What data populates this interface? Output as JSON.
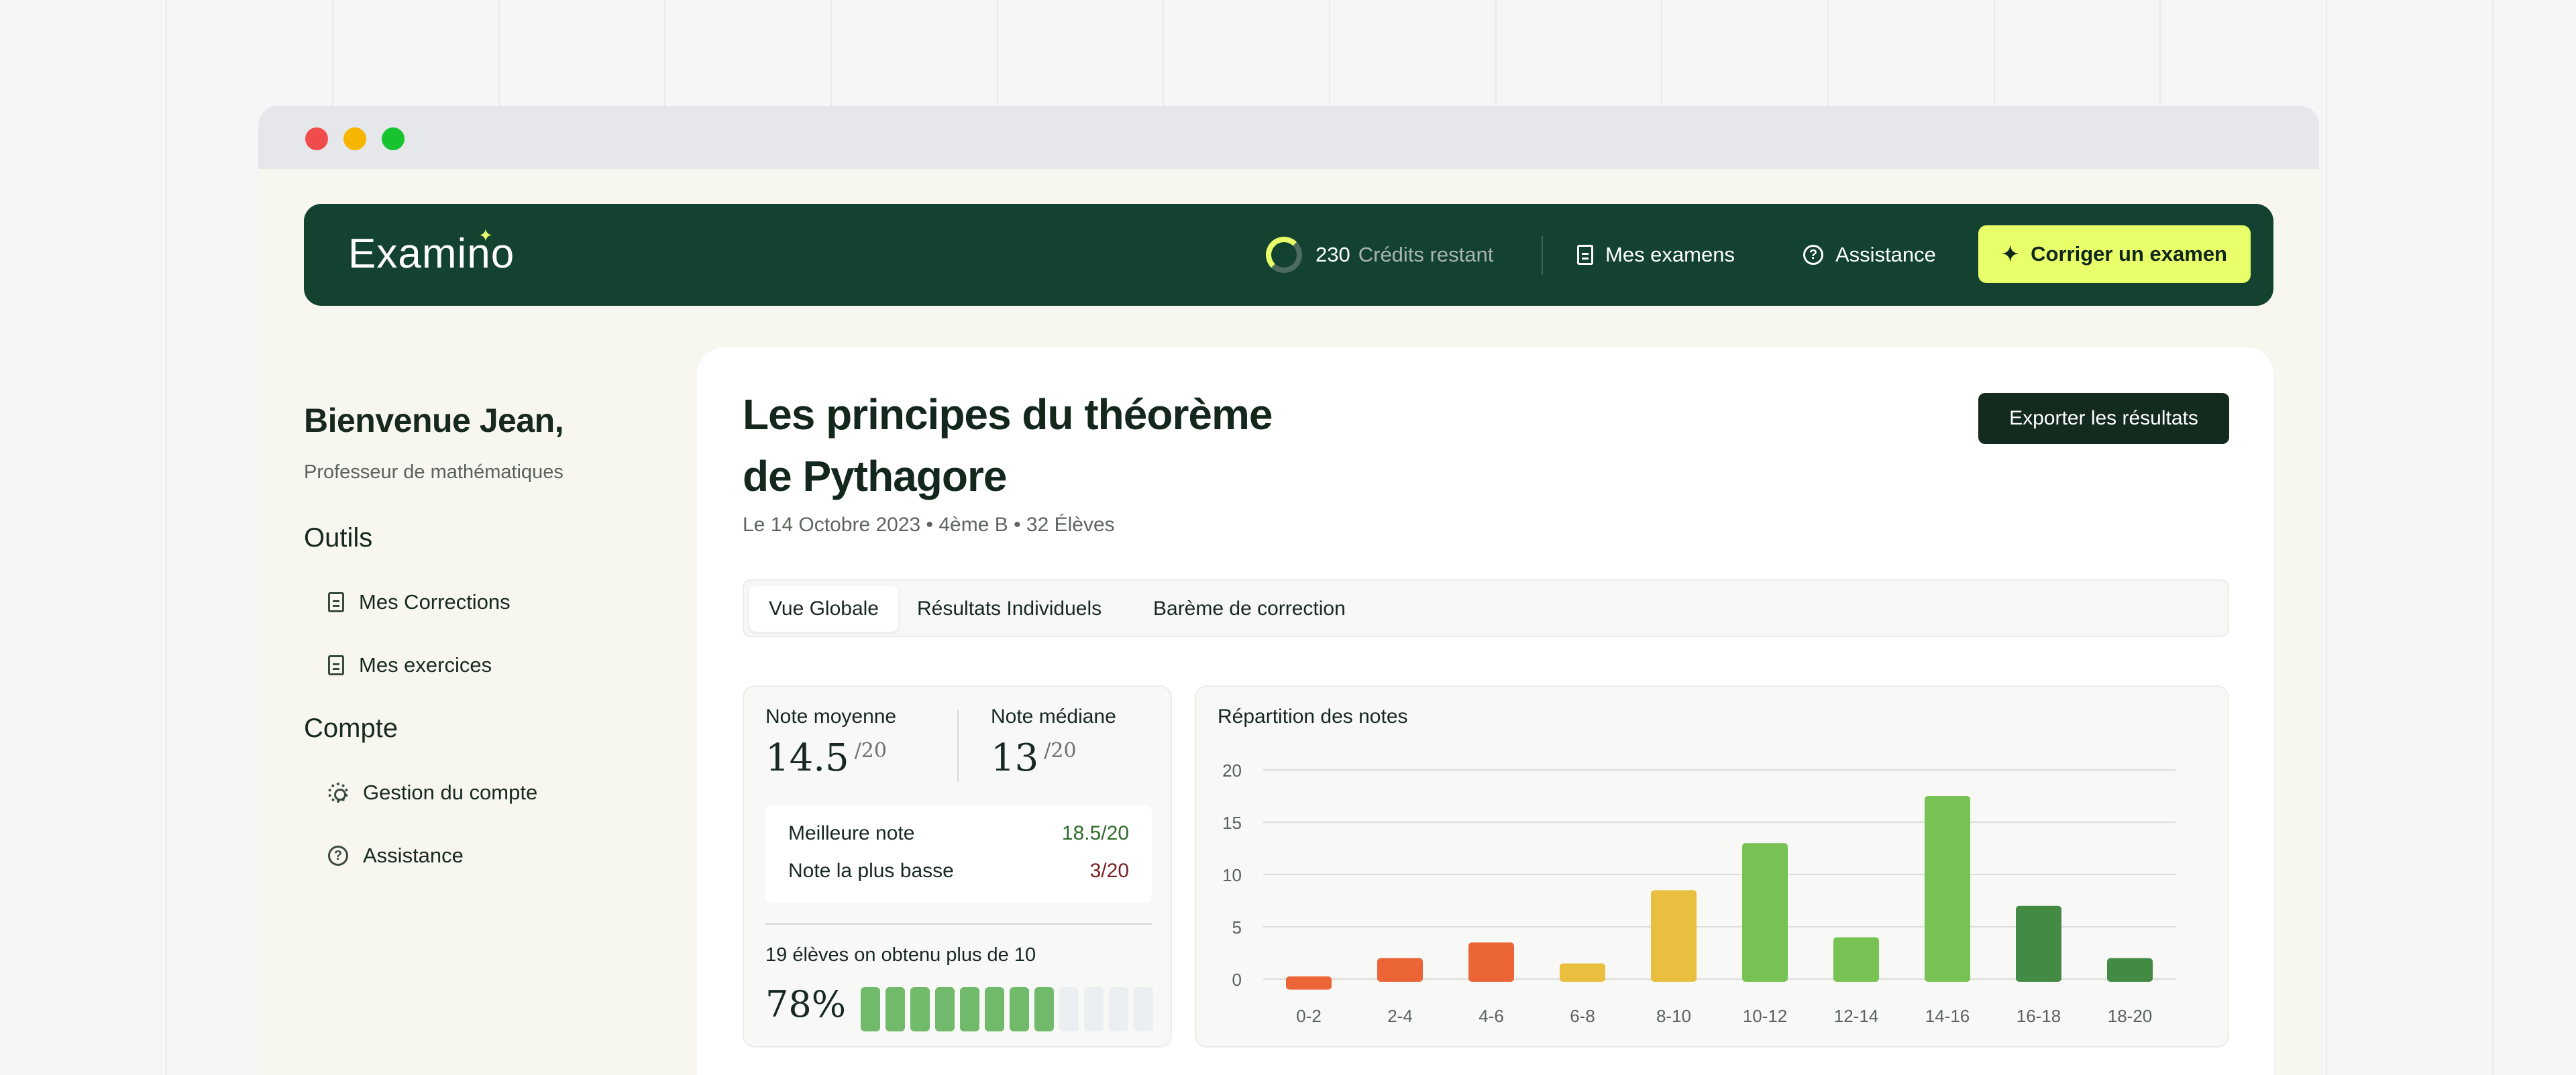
{
  "app": {
    "logo": "Examino",
    "credits_count": "230",
    "credits_label": "Crédits restant",
    "nav": {
      "exams": "Mes examens",
      "assistance": "Assistance",
      "cta": "Corriger un examen"
    }
  },
  "sidebar": {
    "welcome": "Bienvenue Jean,",
    "role": "Professeur de mathématiques",
    "tools_title": "Outils",
    "tools": [
      {
        "label": "Mes Corrections",
        "icon": "document-check-icon"
      },
      {
        "label": "Mes exercices",
        "icon": "document-icon"
      }
    ],
    "account_title": "Compte",
    "account": [
      {
        "label": "Gestion du compte",
        "icon": "gear-icon"
      },
      {
        "label": "Assistance",
        "icon": "help-circle-icon"
      }
    ]
  },
  "exam": {
    "title_line1": "Les principes du théorème",
    "title_line2": "de Pythagore",
    "meta": "Le 14 Octobre 2023 • 4ème B • 32 Élèves",
    "export_label": "Exporter les résultats",
    "tabs": [
      "Vue Globale",
      "Résultats Individuels",
      "Barème de correction"
    ],
    "active_tab": "Vue Globale"
  },
  "stats": {
    "mean_label": "Note moyenne",
    "mean_value": "14.5",
    "mean_suffix": "/20",
    "median_label": "Note médiane",
    "median_value": "13",
    "median_suffix": "/20",
    "best_label": "Meilleure note",
    "best_value": "18.5/20",
    "low_label": "Note la plus basse",
    "low_value": "3/20",
    "above_note": "19 élèves on obtenu plus de 10",
    "percent": "78%",
    "segments_total": 12,
    "segments_filled": 8
  },
  "colors": {
    "navbar": "#134231",
    "accent": "#e9ff6a",
    "bar_red": "#ec6537",
    "bar_yellow": "#e9bf40",
    "bar_green": "#78c153",
    "bar_dark_green": "#438b45"
  },
  "chart_data": {
    "type": "bar",
    "title": "Répartition des notes",
    "categories": [
      "0-2",
      "2-4",
      "4-6",
      "6-8",
      "8-10",
      "10-12",
      "12-14",
      "14-16",
      "16-18",
      "18-20"
    ],
    "values": [
      -1,
      2,
      3.5,
      1.5,
      8.5,
      13,
      4,
      17.5,
      7,
      2
    ],
    "colors": [
      "#ec6537",
      "#ec6537",
      "#ec6537",
      "#e9bf40",
      "#e9bf40",
      "#78c153",
      "#78c153",
      "#78c153",
      "#438b45",
      "#438b45"
    ],
    "yticks": [
      20,
      15,
      10,
      5,
      0
    ],
    "ylim": [
      0,
      20
    ],
    "grid": true
  }
}
